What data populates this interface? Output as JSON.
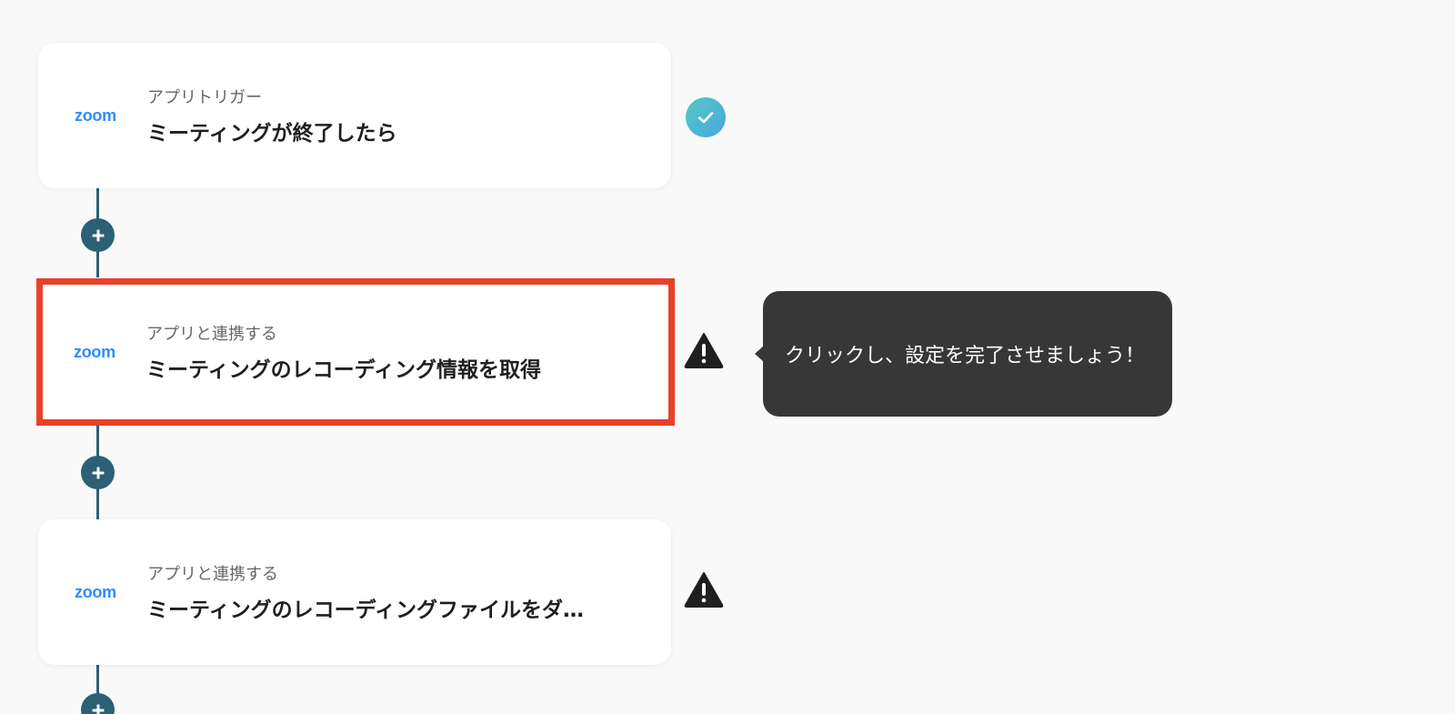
{
  "steps": [
    {
      "logo": "zoom",
      "subtitle": "アプリトリガー",
      "title": "ミーティングが終了したら",
      "status_icon": "check-circle-icon"
    },
    {
      "logo": "zoom",
      "subtitle": "アプリと連携する",
      "title": "ミーティングのレコーディング情報を取得",
      "status_icon": "warning-icon"
    },
    {
      "logo": "zoom",
      "subtitle": "アプリと連携する",
      "title": "ミーティングのレコーディングファイルをダ…",
      "status_icon": "warning-icon"
    }
  ],
  "tooltip": {
    "text": "クリックし、設定を完了させましょう！"
  },
  "colors": {
    "background": "#f9f9f9",
    "connector": "#2b6075",
    "highlight_border": "#e8412a",
    "zoom_blue": "#2d8cff",
    "tooltip_bg": "#373737",
    "check_gradient_start": "#52c9c4",
    "check_gradient_end": "#4aa6e2"
  }
}
